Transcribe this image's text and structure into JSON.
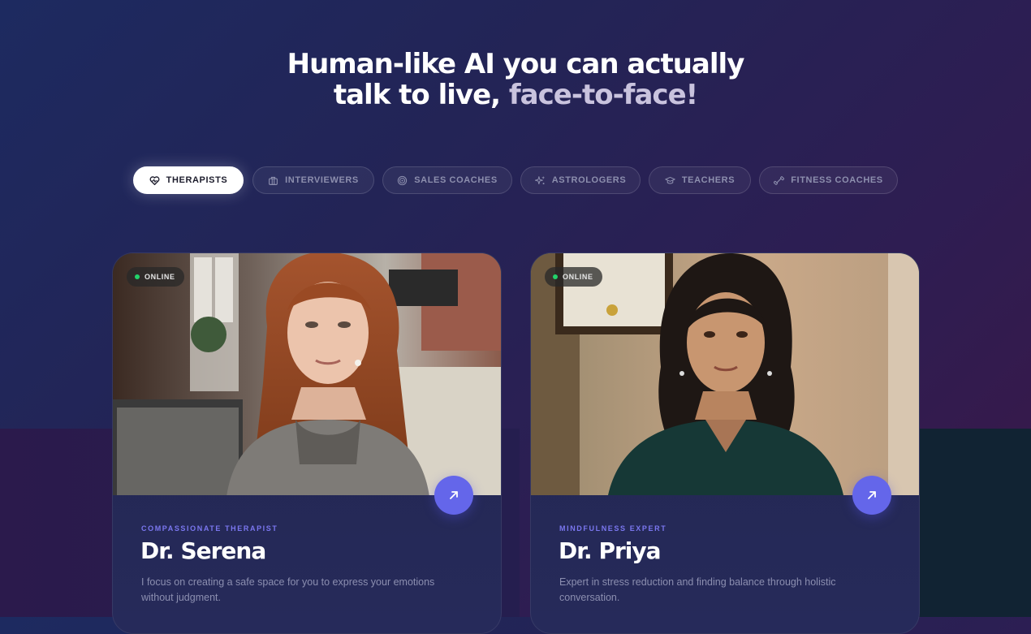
{
  "headline": {
    "line1": "Human-like AI you can actually",
    "line2_a": "talk to live,",
    "line2_b": "face-to-face!"
  },
  "tabs": [
    {
      "label": "THERAPISTS",
      "icon": "heart-pulse-icon",
      "active": true
    },
    {
      "label": "INTERVIEWERS",
      "icon": "briefcase-icon",
      "active": false
    },
    {
      "label": "SALES COACHES",
      "icon": "target-icon",
      "active": false
    },
    {
      "label": "ASTROLOGERS",
      "icon": "sparkles-icon",
      "active": false
    },
    {
      "label": "TEACHERS",
      "icon": "graduation-cap-icon",
      "active": false
    },
    {
      "label": "FITNESS COACHES",
      "icon": "dumbbell-icon",
      "active": false
    }
  ],
  "cards": [
    {
      "status": "ONLINE",
      "role": "COMPASSIONATE THERAPIST",
      "name": "Dr. Serena",
      "description": "I focus on creating a safe space for you to express your emotions without judgment.",
      "action_icon": "arrow-up-right-icon"
    },
    {
      "status": "ONLINE",
      "role": "MINDFULNESS EXPERT",
      "name": "Dr. Priya",
      "description": "Expert in stress reduction and finding balance through holistic conversation.",
      "action_icon": "arrow-up-right-icon"
    }
  ],
  "colors": {
    "accent": "#6466ea",
    "online_dot": "#22d36a",
    "role_text": "#7b77f0"
  }
}
